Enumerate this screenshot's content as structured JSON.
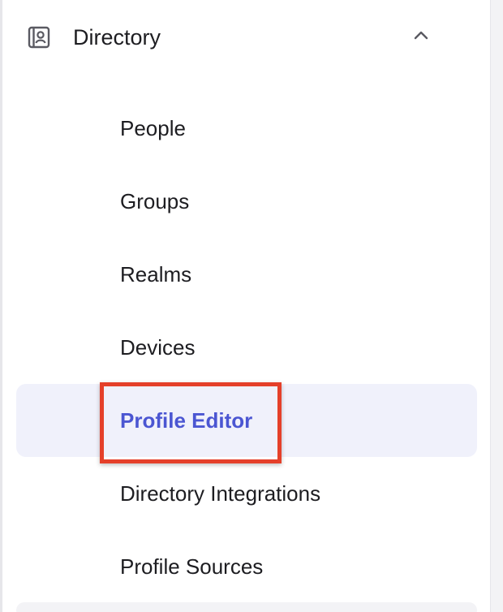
{
  "sidebar": {
    "section": {
      "title": "Directory",
      "icon": "directory-icon",
      "expanded": true
    },
    "items": [
      {
        "label": "People",
        "active": false
      },
      {
        "label": "Groups",
        "active": false
      },
      {
        "label": "Realms",
        "active": false
      },
      {
        "label": "Devices",
        "active": false
      },
      {
        "label": "Profile Editor",
        "active": true
      },
      {
        "label": "Directory Integrations",
        "active": false
      },
      {
        "label": "Profile Sources",
        "active": false
      }
    ]
  },
  "colors": {
    "active_text": "#4b56d2",
    "active_bg": "#f0f1fb",
    "highlight_border": "#e5402a",
    "text": "#1d1d21"
  }
}
